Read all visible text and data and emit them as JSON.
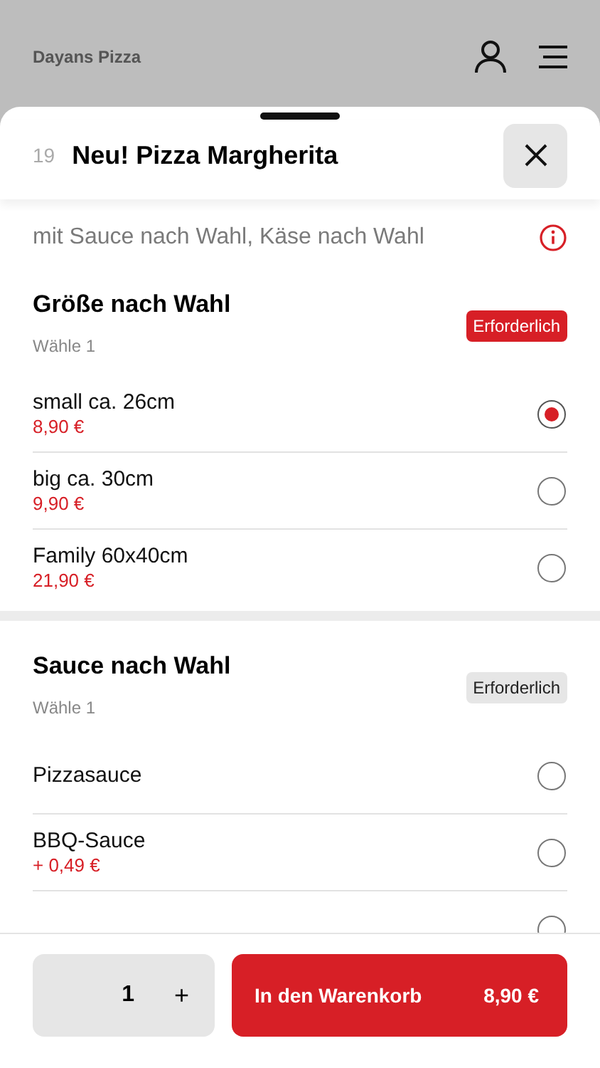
{
  "app_bar": {
    "title": "Dayans Pizza"
  },
  "sheet": {
    "number": "19",
    "title": "Neu! Pizza Margherita",
    "description": "mit Sauce nach Wahl, Käse nach Wahl"
  },
  "groups": [
    {
      "title": "Größe nach Wahl",
      "hint": "Wähle 1",
      "badge": "Erforderlich",
      "badge_active": true,
      "options": [
        {
          "name": "small ca. 26cm",
          "price": "8,90 €",
          "selected": true
        },
        {
          "name": "big ca. 30cm",
          "price": "9,90 €",
          "selected": false
        },
        {
          "name": "Family 60x40cm",
          "price": "21,90 €",
          "selected": false
        }
      ]
    },
    {
      "title": "Sauce nach Wahl",
      "hint": "Wähle 1",
      "badge": "Erforderlich",
      "badge_active": false,
      "options": [
        {
          "name": "Pizzasauce",
          "selected": false
        },
        {
          "name": "BBQ-Sauce",
          "price": "+ 0,49 €",
          "selected": false
        },
        {
          "selected": false
        }
      ]
    }
  ],
  "footer": {
    "quantity": "1",
    "plus": "+",
    "cart_label": "In den Warenkorb",
    "cart_price": "8,90 €"
  }
}
